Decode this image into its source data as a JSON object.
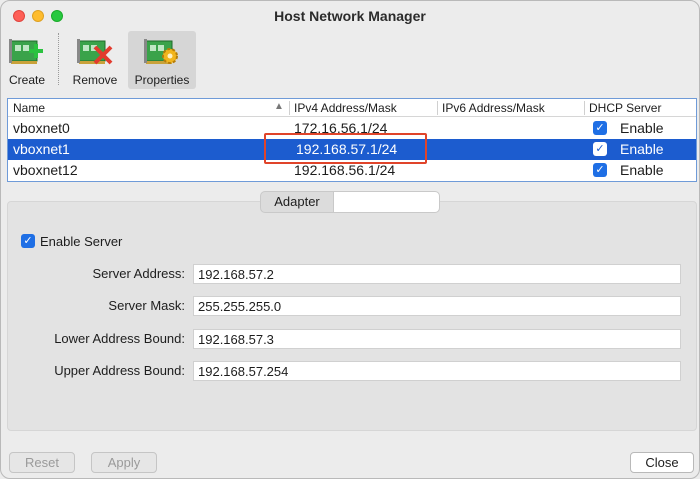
{
  "window": {
    "title": "Host Network Manager"
  },
  "toolbar": {
    "create_label": "Create",
    "remove_label": "Remove",
    "properties_label": "Properties"
  },
  "table": {
    "headers": [
      "Name",
      "IPv4 Address/Mask",
      "IPv6 Address/Mask",
      "DHCP Server"
    ],
    "rows": [
      {
        "name": "vboxnet0",
        "ipv4": "172.16.56.1/24",
        "ipv6": "",
        "dhcp": "Enable",
        "dhcp_checked": true
      },
      {
        "name": "vboxnet1",
        "ipv4": "192.168.57.1/24",
        "ipv6": "",
        "dhcp": "Enable",
        "dhcp_checked": true
      },
      {
        "name": "vboxnet12",
        "ipv4": "192.168.56.1/24",
        "ipv6": "",
        "dhcp": "Enable",
        "dhcp_checked": true
      }
    ],
    "selected_row": "vboxnet1"
  },
  "tabs": {
    "adapter": "Adapter",
    "dhcp": ""
  },
  "dhcp": {
    "enable_server_label": "Enable Server",
    "enable_server_checked": true,
    "server_address_label": "Server Address:",
    "server_address": "192.168.57.2",
    "server_mask_label": "Server Mask:",
    "server_mask": "255.255.255.0",
    "lower_bound_label": "Lower Address Bound:",
    "lower_bound": "192.168.57.3",
    "upper_bound_label": "Upper Address Bound:",
    "upper_bound": "192.168.57.254"
  },
  "buttons": {
    "reset": "Reset",
    "apply": "Apply",
    "close": "Close"
  },
  "colors": {
    "selection": "#1c5ccf",
    "highlight": "#e0442a",
    "checkbox": "#1f6fe5"
  },
  "icons": [
    "network-card-create-icon",
    "network-card-remove-icon",
    "network-card-properties-icon",
    "checkmark-icon",
    "sort-ascending-icon"
  ]
}
